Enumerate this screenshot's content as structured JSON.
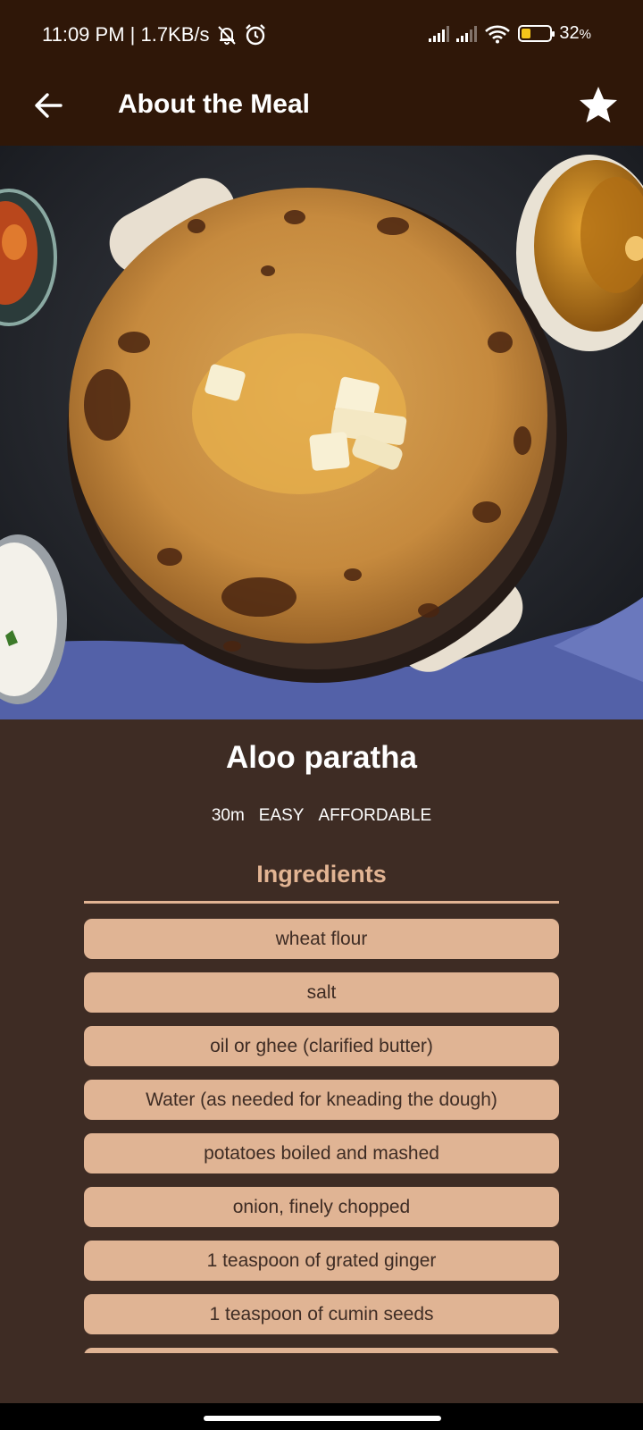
{
  "status_bar": {
    "time": "11:09 PM | 1.7KB/s",
    "icons": [
      "muted-bell-icon",
      "alarm-icon",
      "signal-icon",
      "signal-icon",
      "wifi-icon",
      "battery-icon"
    ],
    "battery_percent": "32",
    "battery_level": 0.32,
    "battery_unit": "%"
  },
  "app_bar": {
    "title": "About the Meal",
    "back_icon": "arrow-left-icon",
    "favorite_icon": "star-icon"
  },
  "meal": {
    "name": "Aloo paratha",
    "duration": "30m",
    "complexity": "EASY",
    "affordability": "AFFORDABLE"
  },
  "ingredients": {
    "title": "Ingredients",
    "items": [
      "wheat flour",
      "salt",
      "oil or ghee (clarified butter)",
      "Water (as needed for kneading the dough)",
      "potatoes boiled and mashed",
      "onion, finely chopped",
      "1 teaspoon of grated ginger",
      "1 teaspoon of cumin seeds"
    ]
  },
  "colors": {
    "app_bar": "#2f1708",
    "background": "#3e2c24",
    "accent": "#e2b493",
    "chip": "#e0b494"
  }
}
